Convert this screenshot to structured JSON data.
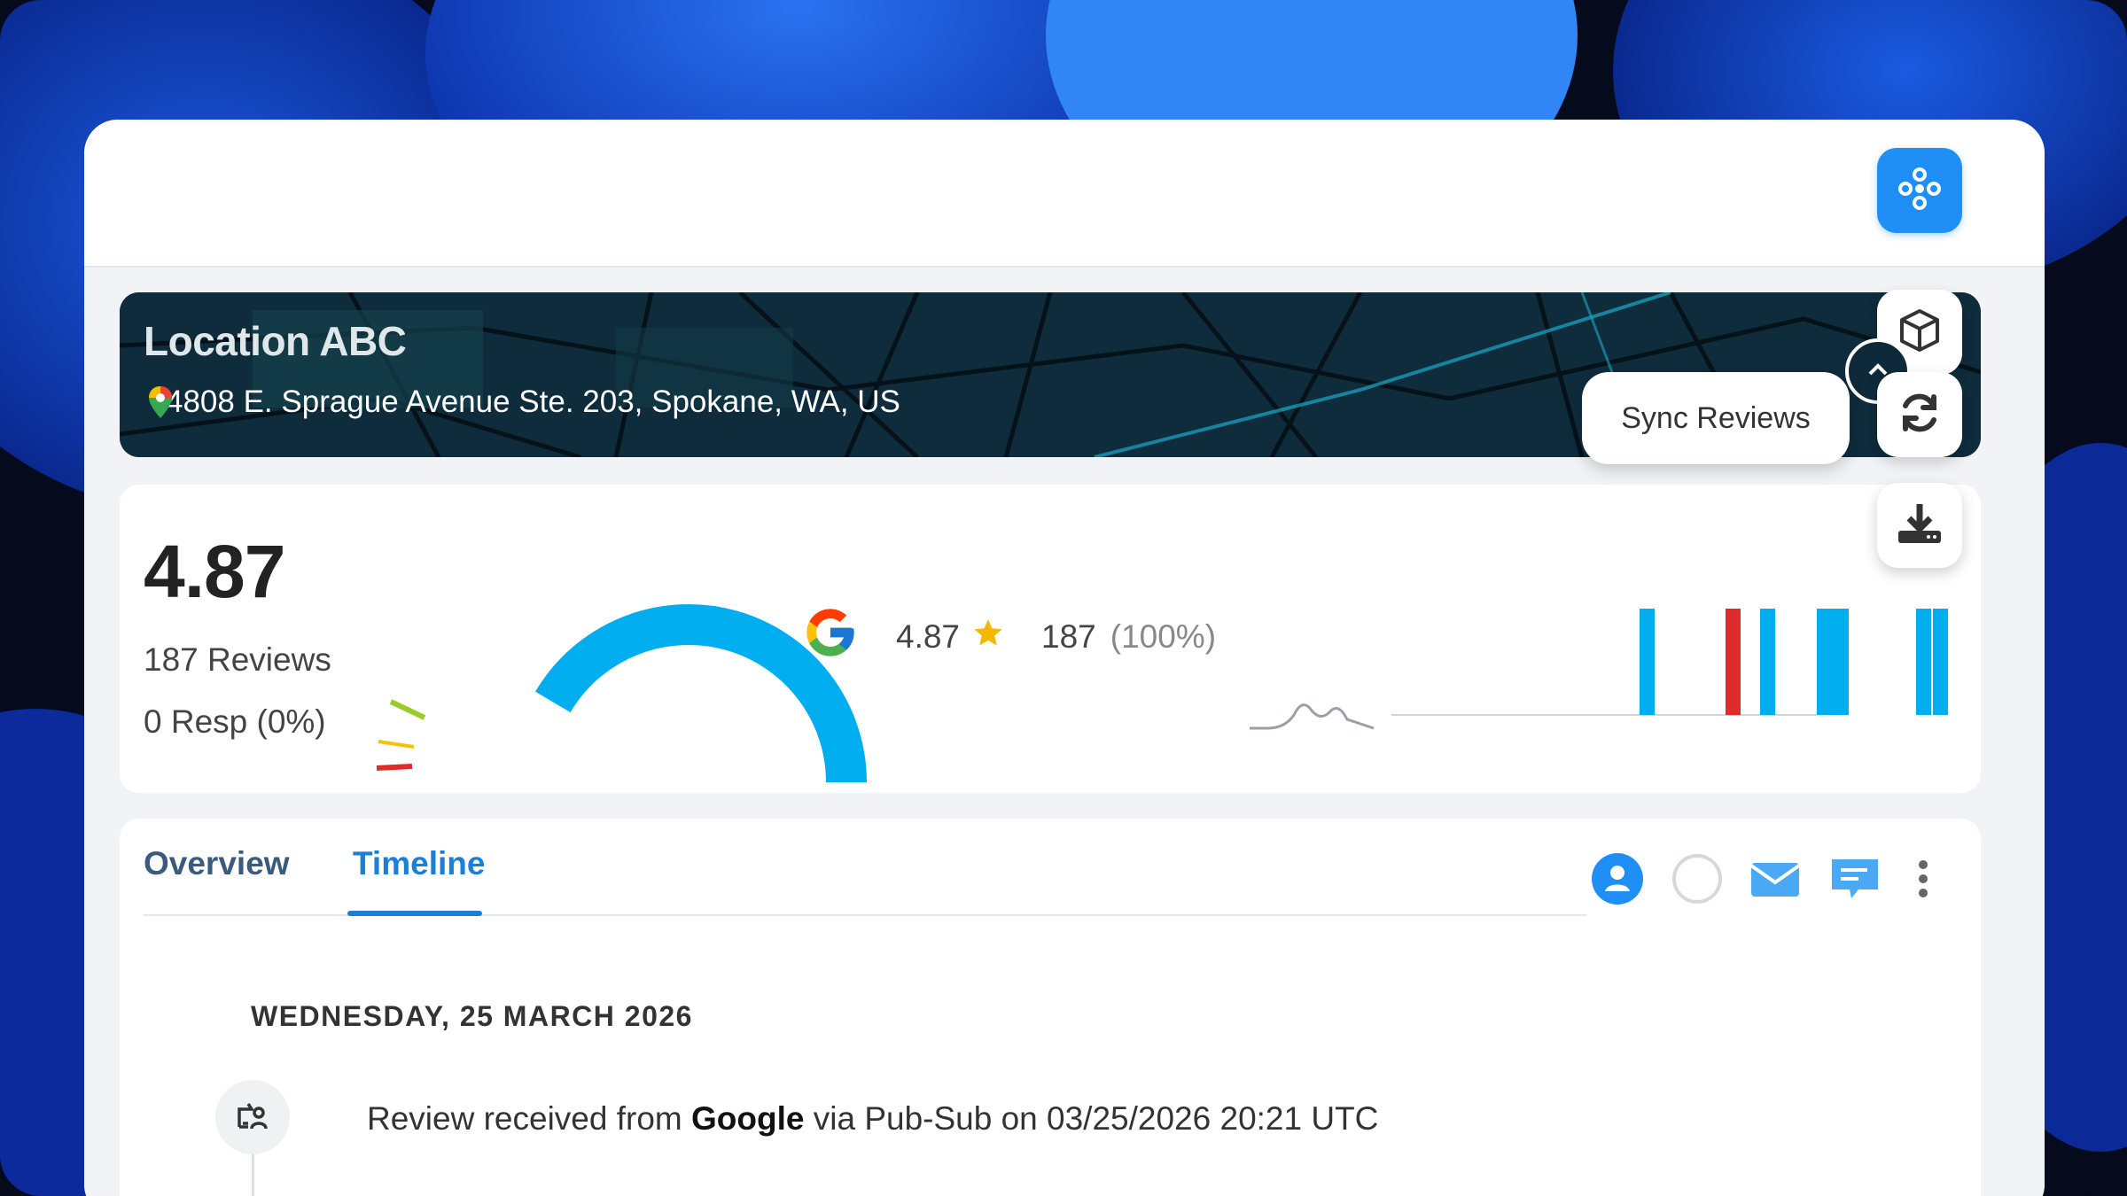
{
  "colors": {
    "accent": "#1f8ef5",
    "gauge": "#00aeef",
    "bar_blue": "#00aeef",
    "bar_red": "#e02b2b",
    "star": "#f5b800",
    "tab_active": "#1a7fd6",
    "tab_inactive": "#3a5a80"
  },
  "location": {
    "name": "Location ABC",
    "address": "4808 E. Sprague Avenue Ste. 203, Spokane, WA, US",
    "pin_icon": "map-pin-icon"
  },
  "actions": {
    "sync_label": "Sync Reviews",
    "sync_icon": "refresh-icon",
    "box_icon": "cube-icon",
    "download_icon": "download-icon",
    "app_icon": "apps-icon",
    "collapse_icon": "chevron-up-icon"
  },
  "stats": {
    "rating": "4.87",
    "reviews": "187 Reviews",
    "responses": "0 Resp (0%)",
    "gauge_fraction": 0.97
  },
  "google": {
    "icon": "google-icon",
    "rating": "4.87",
    "count": "187",
    "percent": "(100%)"
  },
  "tabs": [
    {
      "label": "Overview",
      "active": false
    },
    {
      "label": "Timeline",
      "active": true
    }
  ],
  "tab_icons": [
    "user-icon",
    "circle-icon",
    "mail-icon",
    "comment-icon",
    "more-vertical-icon"
  ],
  "timeline": {
    "date": "WEDNESDAY, 25 MARCH 2026",
    "events": [
      {
        "icon": "sync-review-icon",
        "pre": "Review received from ",
        "source": "Google",
        "post": " via Pub-Sub on 03/25/2026 20:21 UTC"
      }
    ]
  }
}
